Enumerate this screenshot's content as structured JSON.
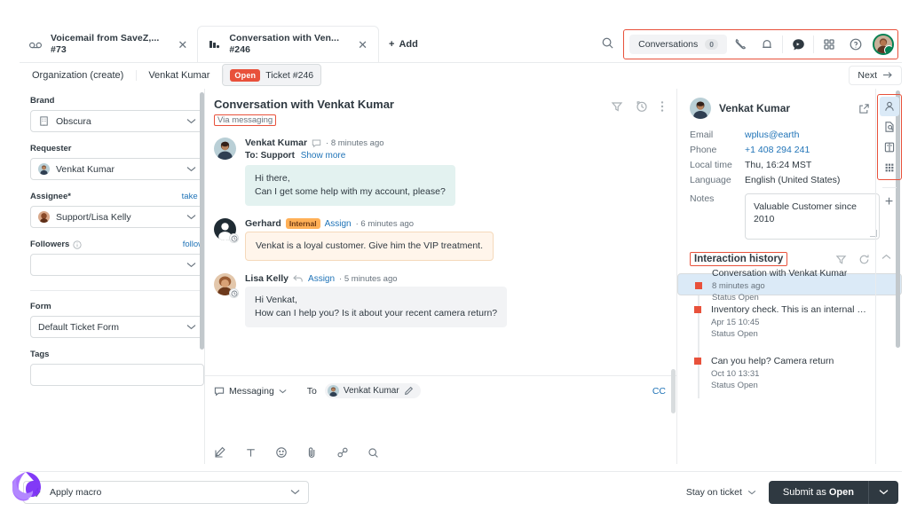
{
  "tabs": [
    {
      "icon": "voicemail-icon",
      "title": "Voicemail from SaveZ,...",
      "id": "#73",
      "active": false
    },
    {
      "icon": "conversation-icon",
      "title": "Conversation with Ven...",
      "id": "#246",
      "active": true
    }
  ],
  "add_tab_label": "Add",
  "toolbar": {
    "search_icon": "search-icon",
    "conversations_label": "Conversations",
    "conversations_count": "0",
    "phone_icon": "phone-icon",
    "bell_icon": "bell-icon",
    "chat_icon": "chat-bubble-icon",
    "apps_icon": "grid-apps-icon",
    "help_icon": "help-circle-icon",
    "avatar_icon": "user-avatar",
    "highlight_color": "#e8513b",
    "online_color": "#038153"
  },
  "breadcrumb": {
    "items": [
      "Organization (create)",
      "Venkat Kumar"
    ],
    "status_badge": "Open",
    "ticket_label": "Ticket #246",
    "next_label": "Next"
  },
  "sidebar": {
    "fields": [
      {
        "label": "Brand",
        "value": "Obscura",
        "icon": "building-icon",
        "link": null
      },
      {
        "label": "Requester",
        "value": "Venkat Kumar",
        "icon": "avatar-venkat",
        "link": null
      },
      {
        "label": "Assignee*",
        "value": "Support/Lisa Kelly",
        "icon": "avatar-lisa",
        "link": "take it"
      },
      {
        "label": "Followers",
        "value": "",
        "icon": null,
        "link": "follow",
        "info_icon": "info-icon"
      }
    ],
    "form": {
      "label": "Form",
      "value": "Default Ticket Form"
    },
    "tags": {
      "label": "Tags",
      "value": ""
    }
  },
  "conversation": {
    "title": "Conversation with Venkat Kumar",
    "via": "Via messaging",
    "header_icons": [
      "filter-icon",
      "history-clock-icon",
      "more-vertical-icon"
    ],
    "messages": [
      {
        "author": "Venkat Kumar",
        "avatar": "avatar-venkat",
        "badge_icon": "chat-bubble-icon",
        "channel_icon": "chat-bubble-icon",
        "time": "8 minutes ago",
        "to_label": "To: Support",
        "show_more": "Show more",
        "tag": null,
        "assign_link": null,
        "text": "Hi there,\nCan I get some help with my account, please?",
        "style": "cust"
      },
      {
        "author": "Gerhard",
        "avatar": "avatar-gerhard",
        "badge_icon": "clock-icon",
        "channel_icon": null,
        "time": "6 minutes ago",
        "to_label": null,
        "show_more": null,
        "tag": "Internal",
        "assign_link": "Assign",
        "text": "Venkat is a loyal customer. Give him the VIP treatment.",
        "style": "note"
      },
      {
        "author": "Lisa Kelly",
        "avatar": "avatar-lisa",
        "badge_icon": "clock-icon",
        "channel_icon": "reply-arrow-icon",
        "time": "5 minutes ago",
        "to_label": null,
        "show_more": null,
        "tag": null,
        "assign_link": "Assign",
        "text": "Hi Venkat,\nHow can I help you? Is it about your recent camera return?",
        "style": "agent"
      }
    ],
    "composer": {
      "channel": "Messaging",
      "channel_icon": "chat-bubble-icon",
      "to_label": "To",
      "to_recipient": "Venkat Kumar",
      "edit_icon": "pencil-icon",
      "cc_label": "CC",
      "placeholder": "",
      "tools": [
        "compose-icon",
        "text-format-icon",
        "emoji-icon",
        "attachment-icon",
        "link-icon",
        "search-icon"
      ]
    }
  },
  "customer": {
    "name": "Venkat Kumar",
    "avatar": "avatar-venkat",
    "open_icon": "external-link-icon",
    "collapse_icon": "chevron-up-icon",
    "details": [
      {
        "label": "Email",
        "value": "wplus@earth",
        "link": true
      },
      {
        "label": "Phone",
        "value": "+1 408 294 241",
        "link": true
      },
      {
        "label": "Local time",
        "value": "Thu, 16:24 MST",
        "link": false
      },
      {
        "label": "Language",
        "value": "English (United States)",
        "link": false
      }
    ],
    "notes_label": "Notes",
    "notes_value": "Valuable Customer since 2010"
  },
  "interaction_history": {
    "title": "Interaction history",
    "icons": [
      "filter-icon",
      "refresh-icon",
      "chevron-up-icon"
    ],
    "items": [
      {
        "title": "Conversation with Venkat Kumar",
        "date": "8 minutes ago",
        "status_label": "Status",
        "status_value": "Open",
        "selected": true
      },
      {
        "title": "Inventory check. This is an internal only...",
        "date": "Apr 15 10:45",
        "status_label": "Status",
        "status_value": "Open",
        "selected": false
      },
      {
        "title": "Can you help? Camera return",
        "date": "Oct 10 13:31",
        "status_label": "Status",
        "status_value": "Open",
        "selected": false
      }
    ]
  },
  "rail": {
    "icons": [
      "user-profile-icon",
      "document-search-icon",
      "knowledge-book-icon",
      "apps-grid-icon"
    ],
    "active_index": 0,
    "add_label": "+"
  },
  "footer": {
    "macro_label": "Apply macro",
    "macro_icon": "lightning-icon",
    "stay_label": "Stay on ticket",
    "submit_prefix": "Submit as ",
    "submit_status": "Open",
    "caret_icon": "chevron-down-icon"
  }
}
